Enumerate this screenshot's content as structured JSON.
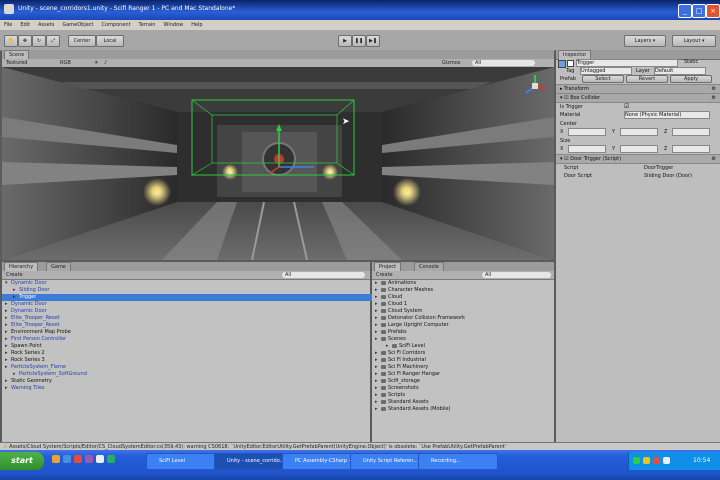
{
  "window": {
    "title": "Unity - scene_corridors1.unity - Scifi Ranger 1 - PC and Mac Standalone*"
  },
  "menu": [
    "File",
    "Edit",
    "Assets",
    "GameObject",
    "Component",
    "Terrain",
    "Window",
    "Help"
  ],
  "toolbar": {
    "pivot": "Center",
    "space": "Local",
    "layers": "Layers",
    "layout": "Layout"
  },
  "scene": {
    "tab": "Scene",
    "shading": "Textured",
    "mode": "RGB",
    "gizmos": "Gizmos",
    "search_hint": "All"
  },
  "hierarchy": {
    "tabs": [
      "Hierarchy",
      "Game"
    ],
    "create": "Create",
    "search_hint": "All",
    "items": [
      {
        "label": "Dynamic Door",
        "indent": 0,
        "expanded": true,
        "blue": true,
        "selected": false
      },
      {
        "label": "Sliding Door",
        "indent": 1,
        "expanded": false,
        "blue": true,
        "selected": false
      },
      {
        "label": "Trigger",
        "indent": 1,
        "expanded": false,
        "blue": false,
        "selected": true
      },
      {
        "label": "Dynamic Door",
        "indent": 0,
        "expanded": false,
        "blue": true,
        "selected": false
      },
      {
        "label": "Dynamic Door",
        "indent": 0,
        "expanded": false,
        "blue": true,
        "selected": false
      },
      {
        "label": "Elite_Trooper_Reset",
        "indent": 0,
        "expanded": false,
        "blue": true,
        "selected": false
      },
      {
        "label": "Elite_Trooper_Reset",
        "indent": 0,
        "expanded": false,
        "blue": true,
        "selected": false
      },
      {
        "label": "Environment Map Probe",
        "indent": 0,
        "expanded": false,
        "blue": false,
        "selected": false
      },
      {
        "label": "First Person Controller",
        "indent": 0,
        "expanded": false,
        "blue": true,
        "selected": false
      },
      {
        "label": "Spawn Point",
        "indent": 0,
        "expanded": false,
        "blue": false,
        "selected": false
      },
      {
        "label": "Rock Series 2",
        "indent": 0,
        "expanded": false,
        "blue": false,
        "selected": false
      },
      {
        "label": "Rock Series 3",
        "indent": 0,
        "expanded": false,
        "blue": false,
        "selected": false
      },
      {
        "label": "ParticleSystem_Flame",
        "indent": 0,
        "expanded": false,
        "blue": true,
        "selected": false
      },
      {
        "label": "ParticleSystem_SoftGround",
        "indent": 1,
        "expanded": false,
        "blue": true,
        "selected": false
      },
      {
        "label": "Static Geometry",
        "indent": 0,
        "expanded": false,
        "blue": false,
        "selected": false
      },
      {
        "label": "Warning Tiles",
        "indent": 0,
        "expanded": false,
        "blue": true,
        "selected": false
      }
    ]
  },
  "project": {
    "tabs": [
      "Project",
      "Console"
    ],
    "create": "Create",
    "search_hint": "All",
    "items": [
      "Animations",
      "Character Meshes",
      "Cloud",
      "Cloud 1",
      "Cloud System",
      "Detonator Collision Framework",
      "Large Upright Computer",
      "Prefabs",
      "Scenes",
      "SciFi Level",
      "Sci Fi Corridors",
      "Sci Fi Industrial",
      "Sci Fi Machinery",
      "Sci Fi Ranger Hangar",
      "Scifi_storage",
      "Screenshots",
      "Scripts",
      "Standard Assets",
      "Standard Assets (Mobile)"
    ]
  },
  "inspector": {
    "tab": "Inspector",
    "object_name": "Trigger",
    "static": "Static",
    "tag_label": "Tag",
    "tag": "Untagged",
    "layer_label": "Layer",
    "layer": "Default",
    "prefab_label": "Prefab",
    "prefab_buttons": [
      "Select",
      "Revert",
      "Apply"
    ],
    "transform": "Transform",
    "box_collider": "Box Collider",
    "is_trigger": "Is Trigger",
    "material_label": "Material",
    "material": "None (Physic Material)",
    "center_label": "Center",
    "size_label": "Size",
    "axes": [
      "X",
      "Y",
      "Z"
    ],
    "script_comp": "Door Trigger (Script)",
    "script_label": "Script",
    "script_value": "DoorTrigger",
    "door_label": "Door Script",
    "door_value": "Sliding Door (Door)"
  },
  "status": "Assets/Cloud System/Scripts/Editor/CS_CloudSystemEditor.cs(359,43): warning CS0618: `UnityEditor.EditorUtility.GetPrefabParent(UnityEngine.Object)' is obsolete: `Use PrefabUtility.GetPrefabParent'",
  "taskbar": {
    "start": "start",
    "tasks": [
      "SciFi Level",
      "Unity - scene_corrido...",
      "PC Assembly-CSharp - A...",
      "Unity Script Referen...",
      "Recording..."
    ],
    "clock": "10:54"
  },
  "colors": {
    "selection": "#3d7bd8",
    "prefab_blue": "#1f3fb0",
    "xp_blue": "#245edb",
    "start_green": "#2f8f2a"
  }
}
